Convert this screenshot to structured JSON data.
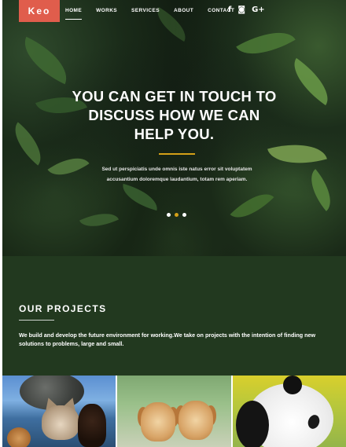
{
  "brand": {
    "logo": "Keo",
    "logo_color": "#e05d4c"
  },
  "nav": {
    "items": [
      {
        "label": "HOME",
        "active": true
      },
      {
        "label": "WORKS",
        "active": false
      },
      {
        "label": "SERVICES",
        "active": false
      },
      {
        "label": "ABOUT",
        "active": false
      },
      {
        "label": "CONTACT",
        "active": false
      }
    ],
    "socials": [
      {
        "icon": "facebook-icon",
        "glyph": "f"
      },
      {
        "icon": "instagram-icon",
        "glyph": "◙"
      },
      {
        "icon": "google-plus-icon",
        "glyph": "G+"
      }
    ]
  },
  "hero": {
    "title_lines": [
      "YOU CAN GET IN TOUCH TO",
      "DISCUSS HOW WE CAN",
      "HELP YOU."
    ],
    "description": "Sed ut perspiciatis unde omnis iste natus error sit voluptatem accusantium doloremque laudantium, totam rem aperiam.",
    "accent_color": "#d4a017",
    "slider": {
      "count": 3,
      "active_index": 1
    }
  },
  "projects": {
    "title": "OUR PROJECTS",
    "description": "We build and develop the future environment for working.We take on projects with the intention of finding new solutions to problems, large and small.",
    "background_color": "#22391f"
  },
  "gallery": {
    "items": [
      {
        "subject": "cat and dogs"
      },
      {
        "subject": "puppies"
      },
      {
        "subject": "panda"
      }
    ]
  }
}
